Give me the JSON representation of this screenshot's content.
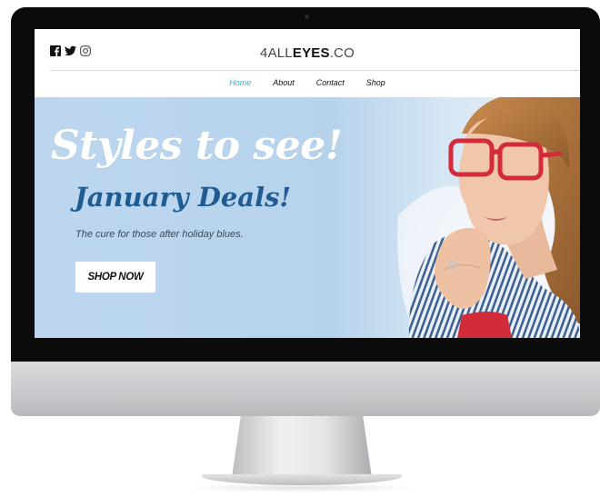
{
  "site": {
    "logo_prefix": "4",
    "logo_all": "ALL",
    "logo_eyes": "EYES",
    "logo_suffix": ".CO"
  },
  "social": [
    {
      "icon": "facebook-icon"
    },
    {
      "icon": "twitter-icon"
    },
    {
      "icon": "instagram-icon"
    }
  ],
  "nav": {
    "items": [
      {
        "label": "Home",
        "active": true
      },
      {
        "label": "About",
        "active": false
      },
      {
        "label": "Contact",
        "active": false
      },
      {
        "label": "Shop",
        "active": false
      }
    ]
  },
  "hero": {
    "title": "Styles to see!",
    "subtitle": "January Deals!",
    "tagline": "The cure for those after holiday blues.",
    "cta_label": "SHOP NOW"
  },
  "colors": {
    "hero_background": "#bcd6ee",
    "nav_active": "#25b5d8",
    "subtitle": "#1f5c92",
    "glasses_frame": "#d22b3a"
  }
}
